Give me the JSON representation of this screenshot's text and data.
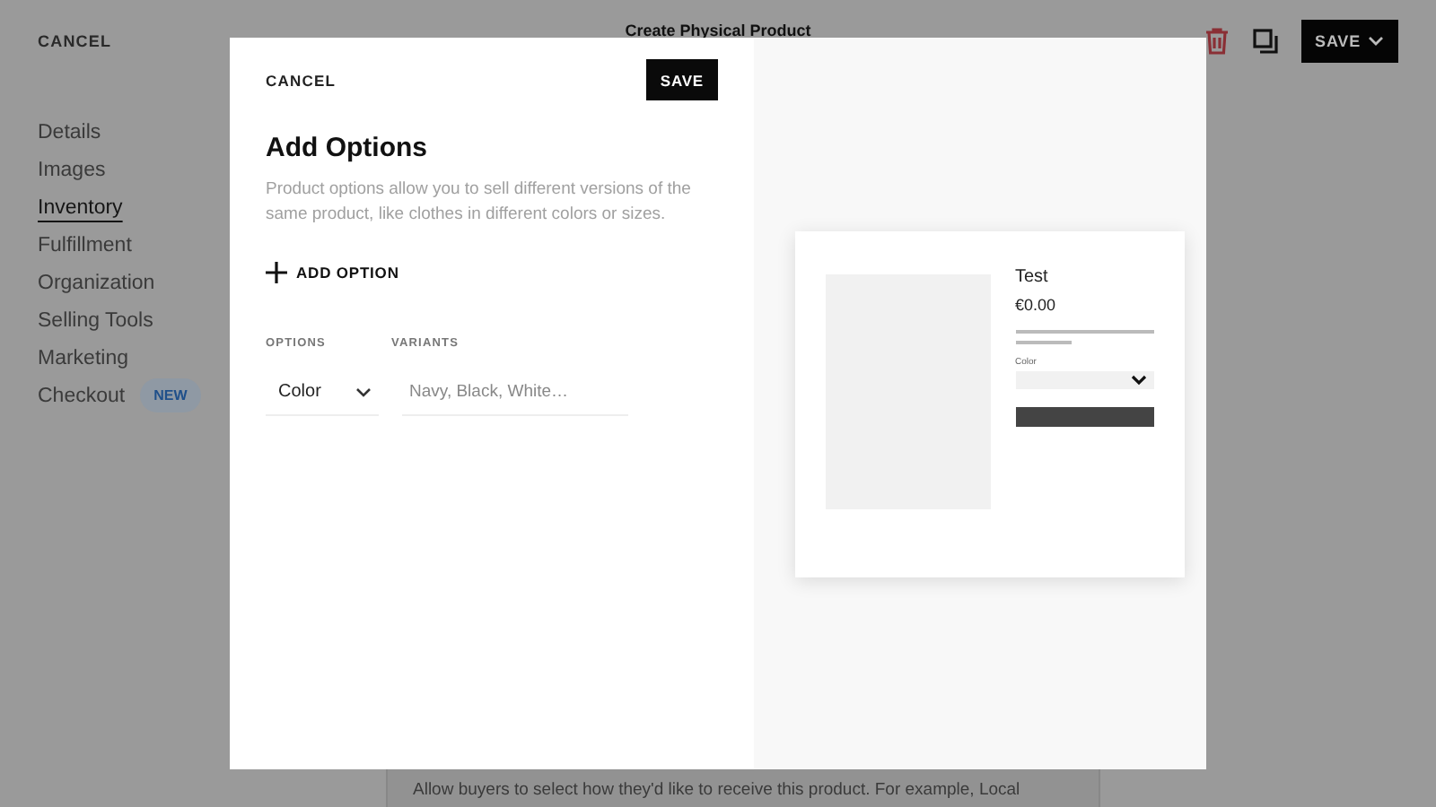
{
  "page": {
    "cancel": "CANCEL",
    "title": "Create Physical Product",
    "save": "SAVE",
    "nav": [
      {
        "label": "Details",
        "selected": false
      },
      {
        "label": "Images",
        "selected": false
      },
      {
        "label": "Inventory",
        "selected": true
      },
      {
        "label": "Fulfillment",
        "selected": false
      },
      {
        "label": "Organization",
        "selected": false
      },
      {
        "label": "Selling Tools",
        "selected": false
      },
      {
        "label": "Marketing",
        "selected": false
      },
      {
        "label": "Checkout",
        "selected": false,
        "badge": "NEW"
      }
    ],
    "fulfillment_note": "Allow buyers to select how they'd like to receive this product. For example, Local"
  },
  "modal": {
    "cancel": "CANCEL",
    "save": "SAVE",
    "heading": "Add Options",
    "description": "Product options allow you to sell different versions of the same product, like clothes in different colors or sizes.",
    "add_option": "ADD OPTION",
    "columns": [
      "OPTIONS",
      "VARIANTS"
    ],
    "options": [
      {
        "name": "Color",
        "placeholder": "Navy, Black, White…"
      }
    ]
  },
  "preview": {
    "title": "Test",
    "price": "€0.00",
    "option_label": "Color"
  }
}
